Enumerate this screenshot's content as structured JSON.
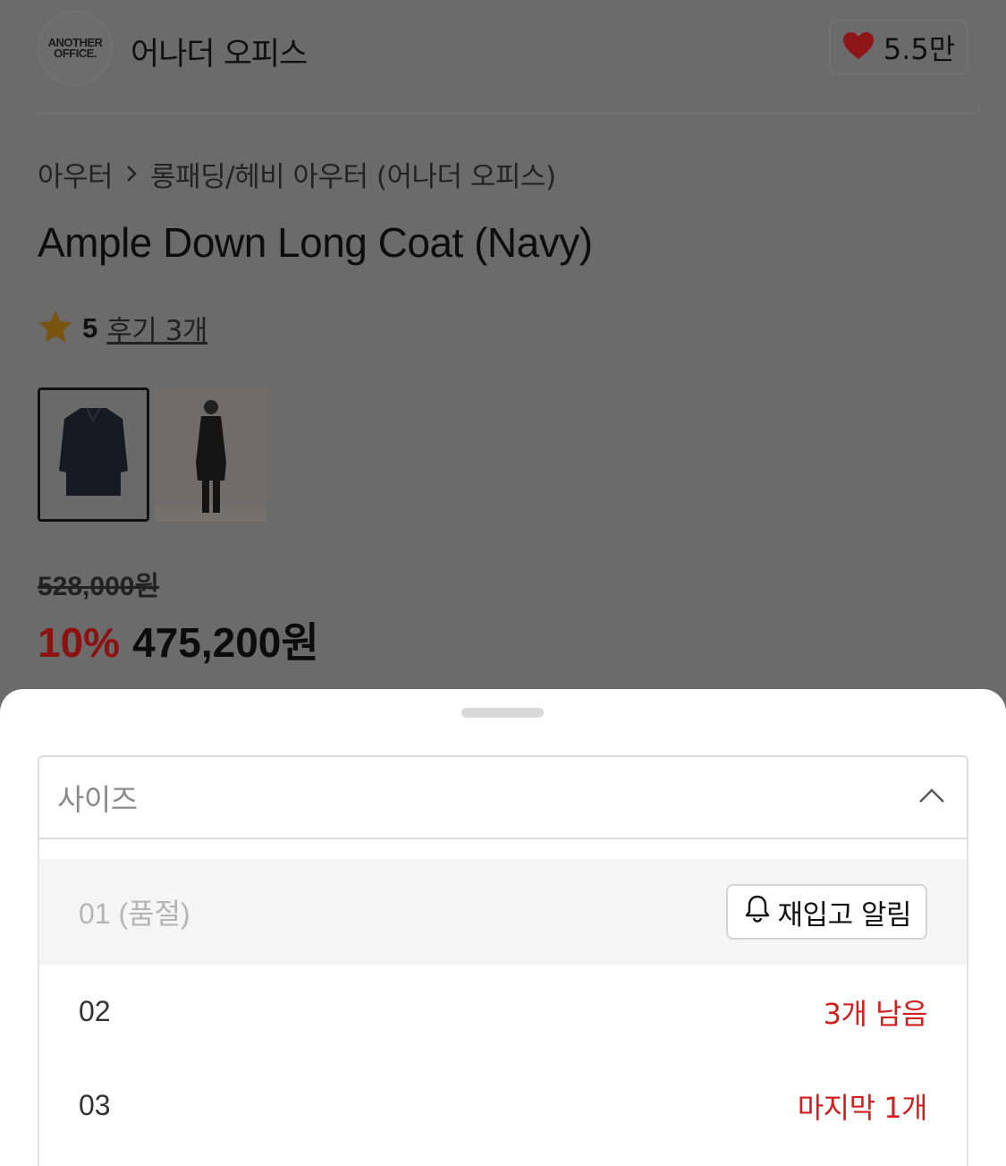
{
  "brand": {
    "logo_line1": "ANOTHER",
    "logo_line2": "OFFICE.",
    "name": "어나더 오피스",
    "like_count": "5.5만",
    "like_icon": "heart-icon",
    "like_color": "#c2161b"
  },
  "breadcrumb": {
    "level1": "아우터",
    "separator_icon": "chevron-right-icon",
    "level2": "롱패딩/헤비 아우터 (어나더 오피스)"
  },
  "product": {
    "title": "Ample Down Long Coat (Navy)",
    "rating": "5",
    "rating_icon": "star-icon",
    "star_color": "#e6a11a",
    "review_link": "후기 3개",
    "thumbnails": [
      "coat-flat-thumbnail",
      "model-wearing-thumbnail"
    ],
    "original_price": "528,000원",
    "discount": "10%",
    "sale_price": "475,200원"
  },
  "sheet": {
    "select_label": "사이즈",
    "select_icon": "chevron-up-icon",
    "options": [
      {
        "label": "01 (품절)",
        "action": "재입고 알림",
        "action_icon": "bell-icon"
      },
      {
        "label": "02",
        "note": "3개 남음"
      },
      {
        "label": "03",
        "note": "마지막 1개"
      }
    ],
    "accent_color": "#d11f1f"
  }
}
